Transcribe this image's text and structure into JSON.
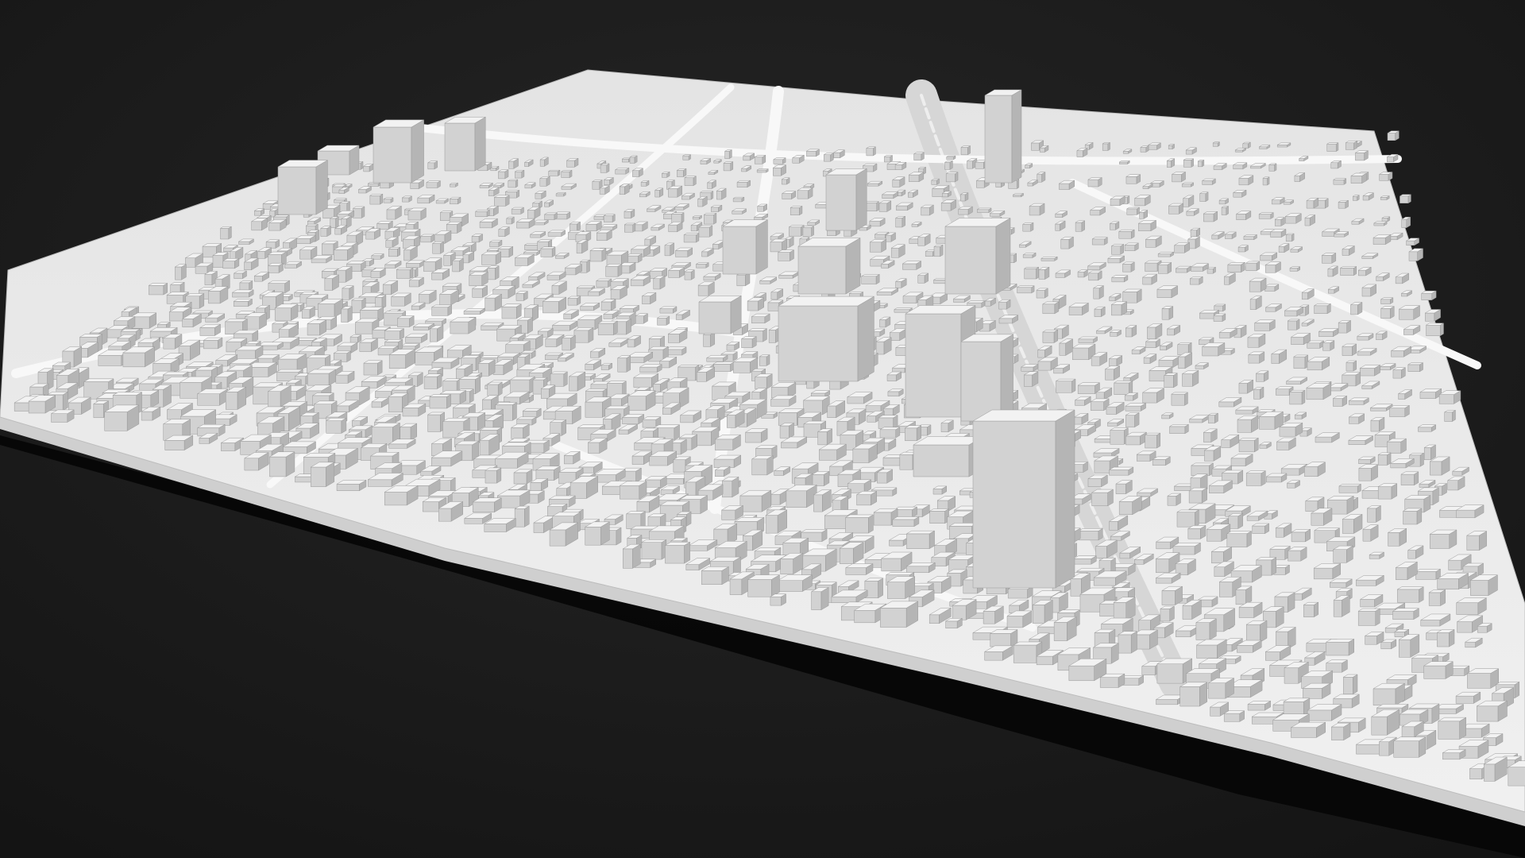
{
  "scene": {
    "subject": "city-block-3d-model",
    "colors": {
      "background": "#1a1a1a",
      "backgroundGlow": "#262626",
      "plateTop": "#e6e6e6",
      "plateEdge": "#cfcfcf",
      "plateShadow": "#050505",
      "road": "#f5f5f5",
      "rail": "#d8d8d8",
      "buildingTop": "#f2f2f2",
      "buildingLeft": "#d2d2d2",
      "buildingRight": "#b5b5b5",
      "buildingStroke": "#9a9a9a"
    }
  }
}
